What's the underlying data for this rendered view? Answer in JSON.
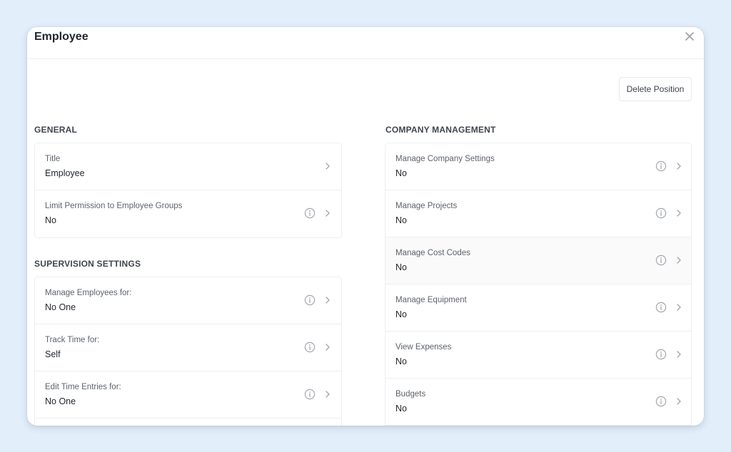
{
  "modal": {
    "title": "Employee",
    "delete_button_label": "Delete Position"
  },
  "general": {
    "heading": "GENERAL",
    "items": [
      {
        "label": "Title",
        "value": "Employee",
        "has_info": false
      },
      {
        "label": "Limit Permission to Employee Groups",
        "value": "No",
        "has_info": true
      }
    ]
  },
  "supervision": {
    "heading": "SUPERVISION SETTINGS",
    "items": [
      {
        "label": "Manage Employees for:",
        "value": "No One",
        "has_info": true
      },
      {
        "label": "Track Time for:",
        "value": "Self",
        "has_info": true
      },
      {
        "label": "Edit Time Entries for:",
        "value": "No One",
        "has_info": true
      }
    ]
  },
  "company_management": {
    "heading": "COMPANY MANAGEMENT",
    "items": [
      {
        "label": "Manage Company Settings",
        "value": "No",
        "has_info": true
      },
      {
        "label": "Manage Projects",
        "value": "No",
        "has_info": true
      },
      {
        "label": "Manage Cost Codes",
        "value": "No",
        "has_info": true
      },
      {
        "label": "Manage Equipment",
        "value": "No",
        "has_info": true
      },
      {
        "label": "View Expenses",
        "value": "No",
        "has_info": true
      },
      {
        "label": "Budgets",
        "value": "No",
        "has_info": true
      }
    ]
  },
  "icons": {
    "close": "close-icon",
    "info": "info-icon",
    "chevron": "chevron-right-icon"
  },
  "colors": {
    "page_background": "#e3eefb",
    "modal_background": "#ffffff",
    "border": "#eceef2",
    "text_primary": "#22272e",
    "text_secondary": "#5d636b"
  }
}
